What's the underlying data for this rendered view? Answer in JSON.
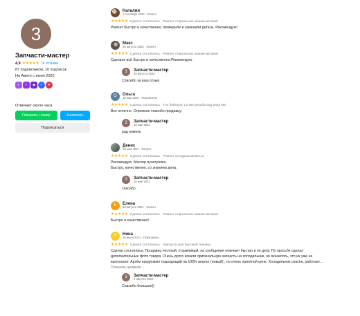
{
  "profile": {
    "initial": "3",
    "name": "Запчасти-мастер",
    "rating": "4,9",
    "reviews_link": "74 отзыва",
    "subscribers": "87 подписчиков, 10 подписок",
    "since": "На Авито с июня 2020",
    "reply_time": "Отвечает около часа",
    "show_number": "Показать номер",
    "write": "Написать",
    "subscribe": "Подписаться"
  },
  "reviews": [
    {
      "author": "Наталия",
      "meta": "1 сентября 2022 · Клиент",
      "deal": "Сделка состоялась · Ремонт стиральных машин-автомат",
      "text": "Ремонт быстро и качественно, проверили и заменили деталь. Рекомендую!"
    },
    {
      "author": "Макс",
      "meta": "25 августа 2022 · Клиент",
      "deal": "Сделка состоялась · Ремонт стиральных машин-автомат",
      "text": "Сделали всё быстро и качественно.Рекомендую.",
      "reply": {
        "author": "Запчасти-мастер",
        "date": "25 августа 2022",
        "text": "Спасибо за ваш отзыв"
      }
    },
    {
      "author": "Ольга",
      "meta": "18 мая 2022 · Покупатель",
      "initial": "О",
      "deal": "Сделка состоялась · Тэн бойлера 1,5 кВт резьба под анод M6",
      "text": "Все отлично. Огромное спасибо продавцу.",
      "reply": {
        "author": "Запчасти-мастер",
        "date": "18 мая 2022",
        "text": "рад помочь"
      }
    },
    {
      "author": "Денис",
      "meta": "16 мая 2022 · Клиент",
      "deal": "Сделка состоялась · Ремонт холодильников LG",
      "text_lines": [
        "Рекомендую. Мастер пунктуален.",
        "Быстро, качественно, со знанием дела."
      ],
      "reply": {
        "author": "Запчасти-мастер",
        "date": "16 мая 2022",
        "text": "спасибо"
      }
    },
    {
      "author": "Елена",
      "meta": "28 августа 2021 · Клиент",
      "initial": "Е",
      "deal": "Сделка состоялась · Ремонт стиральных машин-автомат",
      "text": "Быстро и качественно!"
    },
    {
      "author": "Нина",
      "meta": "30 июля 2021 · Покупатель",
      "initial": "Н",
      "deal": "Сделка состоялась · Запчасти для бытовой техники",
      "text_lines": [
        "Сделка состоялась. Продавец честный, отзывчивый, на сообщения отвечает быстро и по делу. По просьбе сделал",
        "дополнительные фото товара. Очень долго искали оригинальную запчасть на холодильник, но оказалось, что их уже не",
        "выпускают. Артём предложил подходящий на 100% аналог (новый) , по очень приятной цене. Холодильник спасён, работает..."
      ],
      "more": "Показать целиком ⌄",
      "reply": {
        "author": "Запчасти-мастер",
        "date": "2 августа 2021",
        "text": "Спасибо большое))"
      }
    }
  ],
  "stars": "★★★★★",
  "colors": {
    "star": "#ffb021",
    "link": "#0099f7",
    "green": "#02d15c",
    "blue": "#00aaff",
    "avatar": "#8c6f61"
  }
}
